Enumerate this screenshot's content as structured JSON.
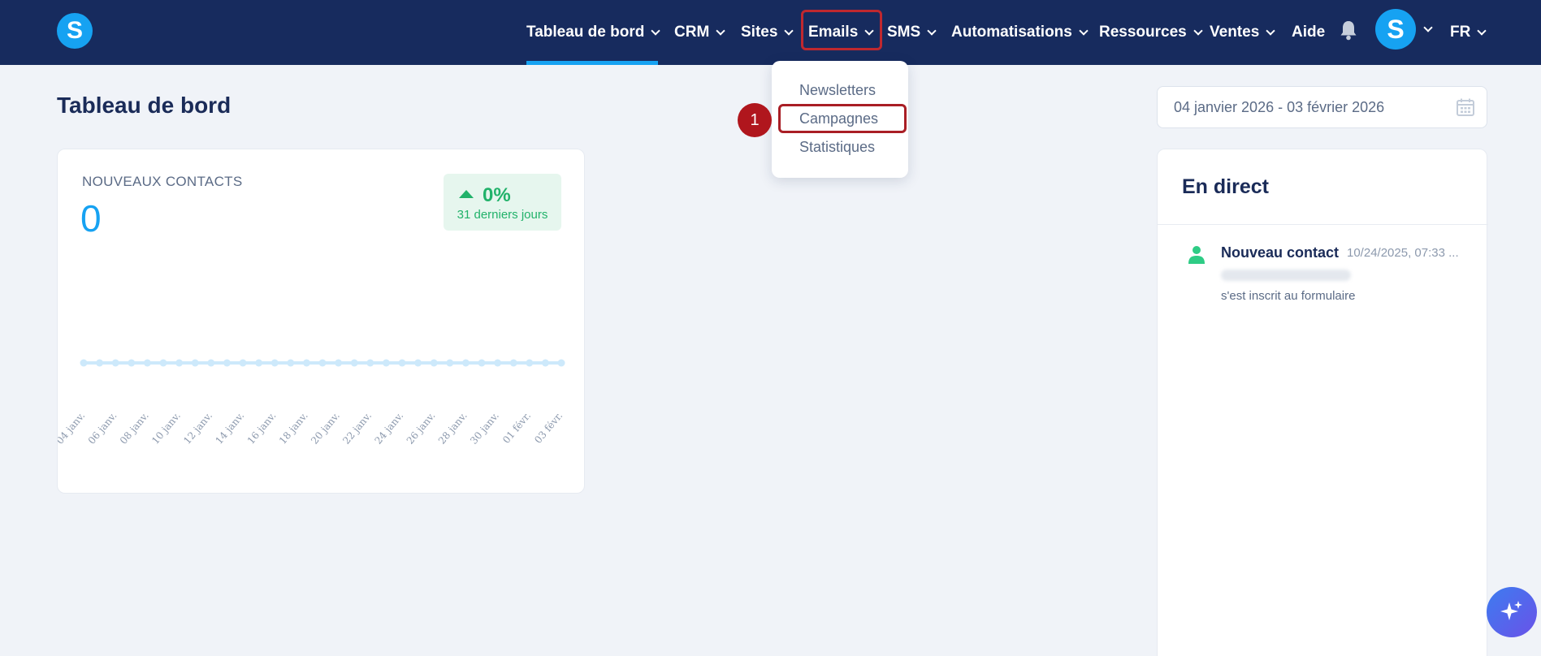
{
  "nav": {
    "items": [
      {
        "label": "Tableau de bord",
        "dropdown": true
      },
      {
        "label": "CRM",
        "dropdown": true
      },
      {
        "label": "Sites",
        "dropdown": true
      },
      {
        "label": "Emails",
        "dropdown": true
      },
      {
        "label": "SMS",
        "dropdown": true
      },
      {
        "label": "Automatisations",
        "dropdown": true
      },
      {
        "label": "Ressources",
        "dropdown": true
      },
      {
        "label": "Ventes",
        "dropdown": true
      },
      {
        "label": "Aide",
        "dropdown": false
      }
    ],
    "active": "Tableau de bord",
    "logo_letter": "S",
    "avatar_letter": "S",
    "language": "FR"
  },
  "dropdown": {
    "items": [
      "Newsletters",
      "Campagnes",
      "Statistiques"
    ],
    "highlighted": "Campagnes"
  },
  "annotation": {
    "step": "1"
  },
  "page": {
    "title": "Tableau de bord"
  },
  "date_range": {
    "value": "04 janvier 2026 - 03 février 2026"
  },
  "contacts_card": {
    "label": "NOUVEAUX CONTACTS",
    "value": "0",
    "trend": "0%",
    "trend_period": "31 derniers jours"
  },
  "chart_data": {
    "type": "line",
    "categories": [
      "04 janv.",
      "05 janv.",
      "06 janv.",
      "07 janv.",
      "08 janv.",
      "09 janv.",
      "10 janv.",
      "11 janv.",
      "12 janv.",
      "13 janv.",
      "14 janv.",
      "15 janv.",
      "16 janv.",
      "17 janv.",
      "18 janv.",
      "19 janv.",
      "20 janv.",
      "21 janv.",
      "22 janv.",
      "23 janv.",
      "24 janv.",
      "25 janv.",
      "26 janv.",
      "27 janv.",
      "28 janv.",
      "29 janv.",
      "30 janv.",
      "31 janv.",
      "01 févr.",
      "02 févr.",
      "03 févr."
    ],
    "tick_labels": [
      "04 janv.",
      "06 janv.",
      "08 janv.",
      "10 janv.",
      "12 janv.",
      "14 janv.",
      "16 janv.",
      "18 janv.",
      "20 janv.",
      "22 janv.",
      "24 janv.",
      "26 janv.",
      "28 janv.",
      "30 janv.",
      "01 févr.",
      "03 févr."
    ],
    "series": [
      {
        "values": [
          0,
          0,
          0,
          0,
          0,
          0,
          0,
          0,
          0,
          0,
          0,
          0,
          0,
          0,
          0,
          0,
          0,
          0,
          0,
          0,
          0,
          0,
          0,
          0,
          0,
          0,
          0,
          0,
          0,
          0,
          0
        ]
      }
    ],
    "color": "#cde9fb",
    "grid": false
  },
  "live": {
    "title": "En direct",
    "events": [
      {
        "title": "Nouveau contact",
        "time": "10/24/2025, 07:33 ...",
        "description": "s'est inscrit au formulaire"
      }
    ]
  },
  "colors": {
    "nav_bg": "#172b5e",
    "accent": "#16a2f2",
    "success": "#21b26a",
    "highlight": "#c0282f"
  },
  "icons": [
    "bell-icon",
    "calendar-icon",
    "person-icon",
    "sparkle-icon",
    "chevron-down-icon"
  ]
}
